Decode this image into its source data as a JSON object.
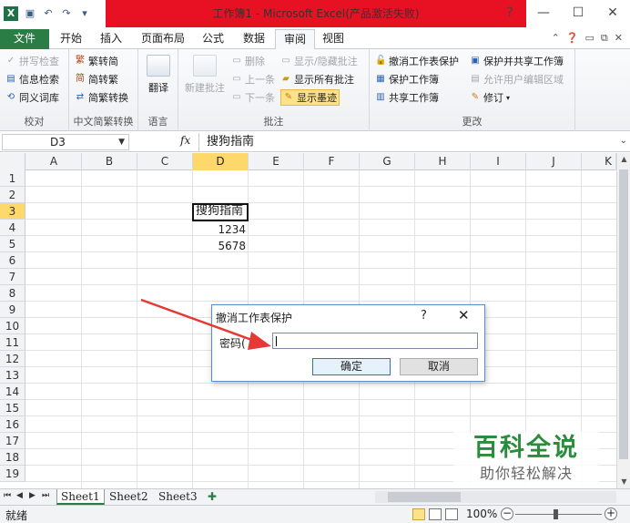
{
  "window": {
    "title": "工作簿1 - Microsoft Excel(产品激活失败)"
  },
  "menu": {
    "file": "文件",
    "tabs": [
      "开始",
      "插入",
      "页面布局",
      "公式",
      "数据",
      "审阅",
      "视图"
    ],
    "active_tab": "审阅"
  },
  "ribbon": {
    "proofing": {
      "items": [
        "拼写检查",
        "信息检索",
        "同义词库"
      ],
      "label": "校对"
    },
    "chinese": {
      "items": [
        "繁转简",
        "简转繁",
        "简繁转换"
      ],
      "label": "中文简繁转换"
    },
    "language": {
      "translate": "翻译",
      "label": "语言"
    },
    "comments": {
      "new": "新建批注",
      "delete": "删除",
      "prev": "上一条",
      "next": "下一条",
      "show_hide": "显示/隐藏批注",
      "show_all": "显示所有批注",
      "show_ink": "显示墨迹",
      "label": "批注"
    },
    "changes": {
      "unprotect_sheet": "撤消工作表保护",
      "protect_workbook": "保护工作簿",
      "share_workbook": "共享工作簿",
      "protect_share": "保护并共享工作簿",
      "allow_edit": "允许用户编辑区域",
      "track": "修订",
      "label": "更改"
    }
  },
  "formula_bar": {
    "name_box": "D3",
    "fx": "fx",
    "content": "搜狗指南"
  },
  "grid": {
    "columns": [
      "A",
      "B",
      "C",
      "D",
      "E",
      "F",
      "G",
      "H",
      "I",
      "J",
      "K"
    ],
    "rows": [
      "1",
      "2",
      "3",
      "4",
      "5",
      "6",
      "7",
      "8",
      "9",
      "10",
      "11",
      "12",
      "13",
      "14",
      "15",
      "16",
      "17",
      "18",
      "19"
    ],
    "cells": {
      "D3": "搜狗指南",
      "D4": "1234",
      "D5": "5678"
    }
  },
  "sheets": [
    "Sheet1",
    "Sheet2",
    "Sheet3"
  ],
  "status": {
    "ready": "就绪",
    "zoom": "100%"
  },
  "dialog": {
    "title": "撤消工作表保护",
    "help": "?",
    "close": "✕",
    "password_label": "密码(",
    "password_value": "",
    "ok": "确定",
    "cancel": "取消"
  },
  "watermark": {
    "main": "百科全说",
    "sub": "助你轻松解决"
  },
  "colors": {
    "file_tab": "#2a7d45",
    "title_red": "#e81123",
    "selected_header": "#ffd86b",
    "watermark_green": "#2a8c3c"
  }
}
